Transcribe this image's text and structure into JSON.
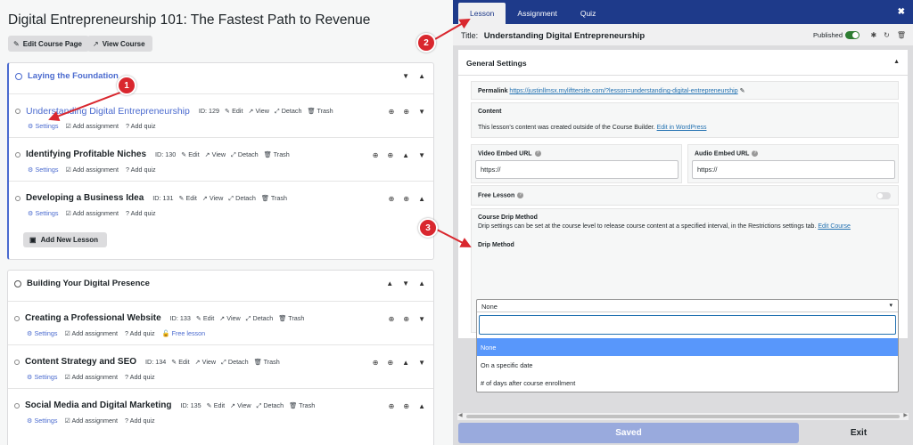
{
  "page": {
    "title": "Digital Entrepreneurship 101: The Fastest Path to Revenue"
  },
  "buttons": {
    "edit_course_page": "Edit Course Page",
    "view_course": "View Course",
    "add_new_lesson": "Add New Lesson"
  },
  "icons": {
    "edit": "✎",
    "view": "↗",
    "detach": "⤢",
    "trash": "🗑",
    "settings": "⚙",
    "assignment": "☑",
    "quiz": "?",
    "free": "🔓",
    "add": "⊕",
    "up": "▲",
    "down": "▼",
    "chev_up": "⌃",
    "chev_down": "⌄"
  },
  "sections": [
    {
      "title": "Laying the Foundation",
      "lessons": [
        {
          "name": "Understanding Digital Entrepreneurship",
          "id": "ID: 129"
        },
        {
          "name": "Identifying Profitable Niches",
          "id": "ID: 130"
        },
        {
          "name": "Developing a Business Idea",
          "id": "ID: 131"
        }
      ]
    },
    {
      "title": "Building Your Digital Presence",
      "lessons": [
        {
          "name": "Creating a Professional Website",
          "id": "ID: 133",
          "free": "Free lesson"
        },
        {
          "name": "Content Strategy and SEO",
          "id": "ID: 134"
        },
        {
          "name": "Social Media and Digital Marketing",
          "id": "ID: 135"
        }
      ]
    }
  ],
  "lesson_actions": {
    "edit": "Edit",
    "view": "View",
    "detach": "Detach",
    "trash": "Trash",
    "settings": "Settings",
    "add_assignment": "Add assignment",
    "add_quiz": "Add quiz"
  },
  "markers": [
    "1",
    "2",
    "3"
  ],
  "editor": {
    "tabs": [
      "Lesson",
      "Assignment",
      "Quiz"
    ],
    "close": "✖",
    "title_label": "Title:",
    "title_value": "Understanding Digital Entrepreneurship",
    "published": "Published",
    "general_settings": "General Settings",
    "permalink_label": "Permalink",
    "permalink_url": "https://justinllmsx.mylifttersite.com/?lesson=understanding-digital-entrepreneurship",
    "content_label": "Content",
    "content_text": "This lesson's content was created outside of the Course Builder.",
    "content_link": "Edit in WordPress",
    "video_label": "Video Embed URL",
    "video_placeholder": "https://",
    "audio_label": "Audio Embed URL",
    "audio_placeholder": "https://",
    "free_lesson": "Free Lesson",
    "drip_title": "Course Drip Method",
    "drip_text": "Drip settings can be set at the course level to release course content at a specified interval, in the Restrictions settings tab.",
    "drip_link": "Edit Course",
    "drip_method": "Drip Method",
    "drip_selected": "None",
    "drip_options": [
      "None",
      "On a specific date",
      "# of days after course enrollment"
    ],
    "saved": "Saved",
    "exit": "Exit"
  }
}
